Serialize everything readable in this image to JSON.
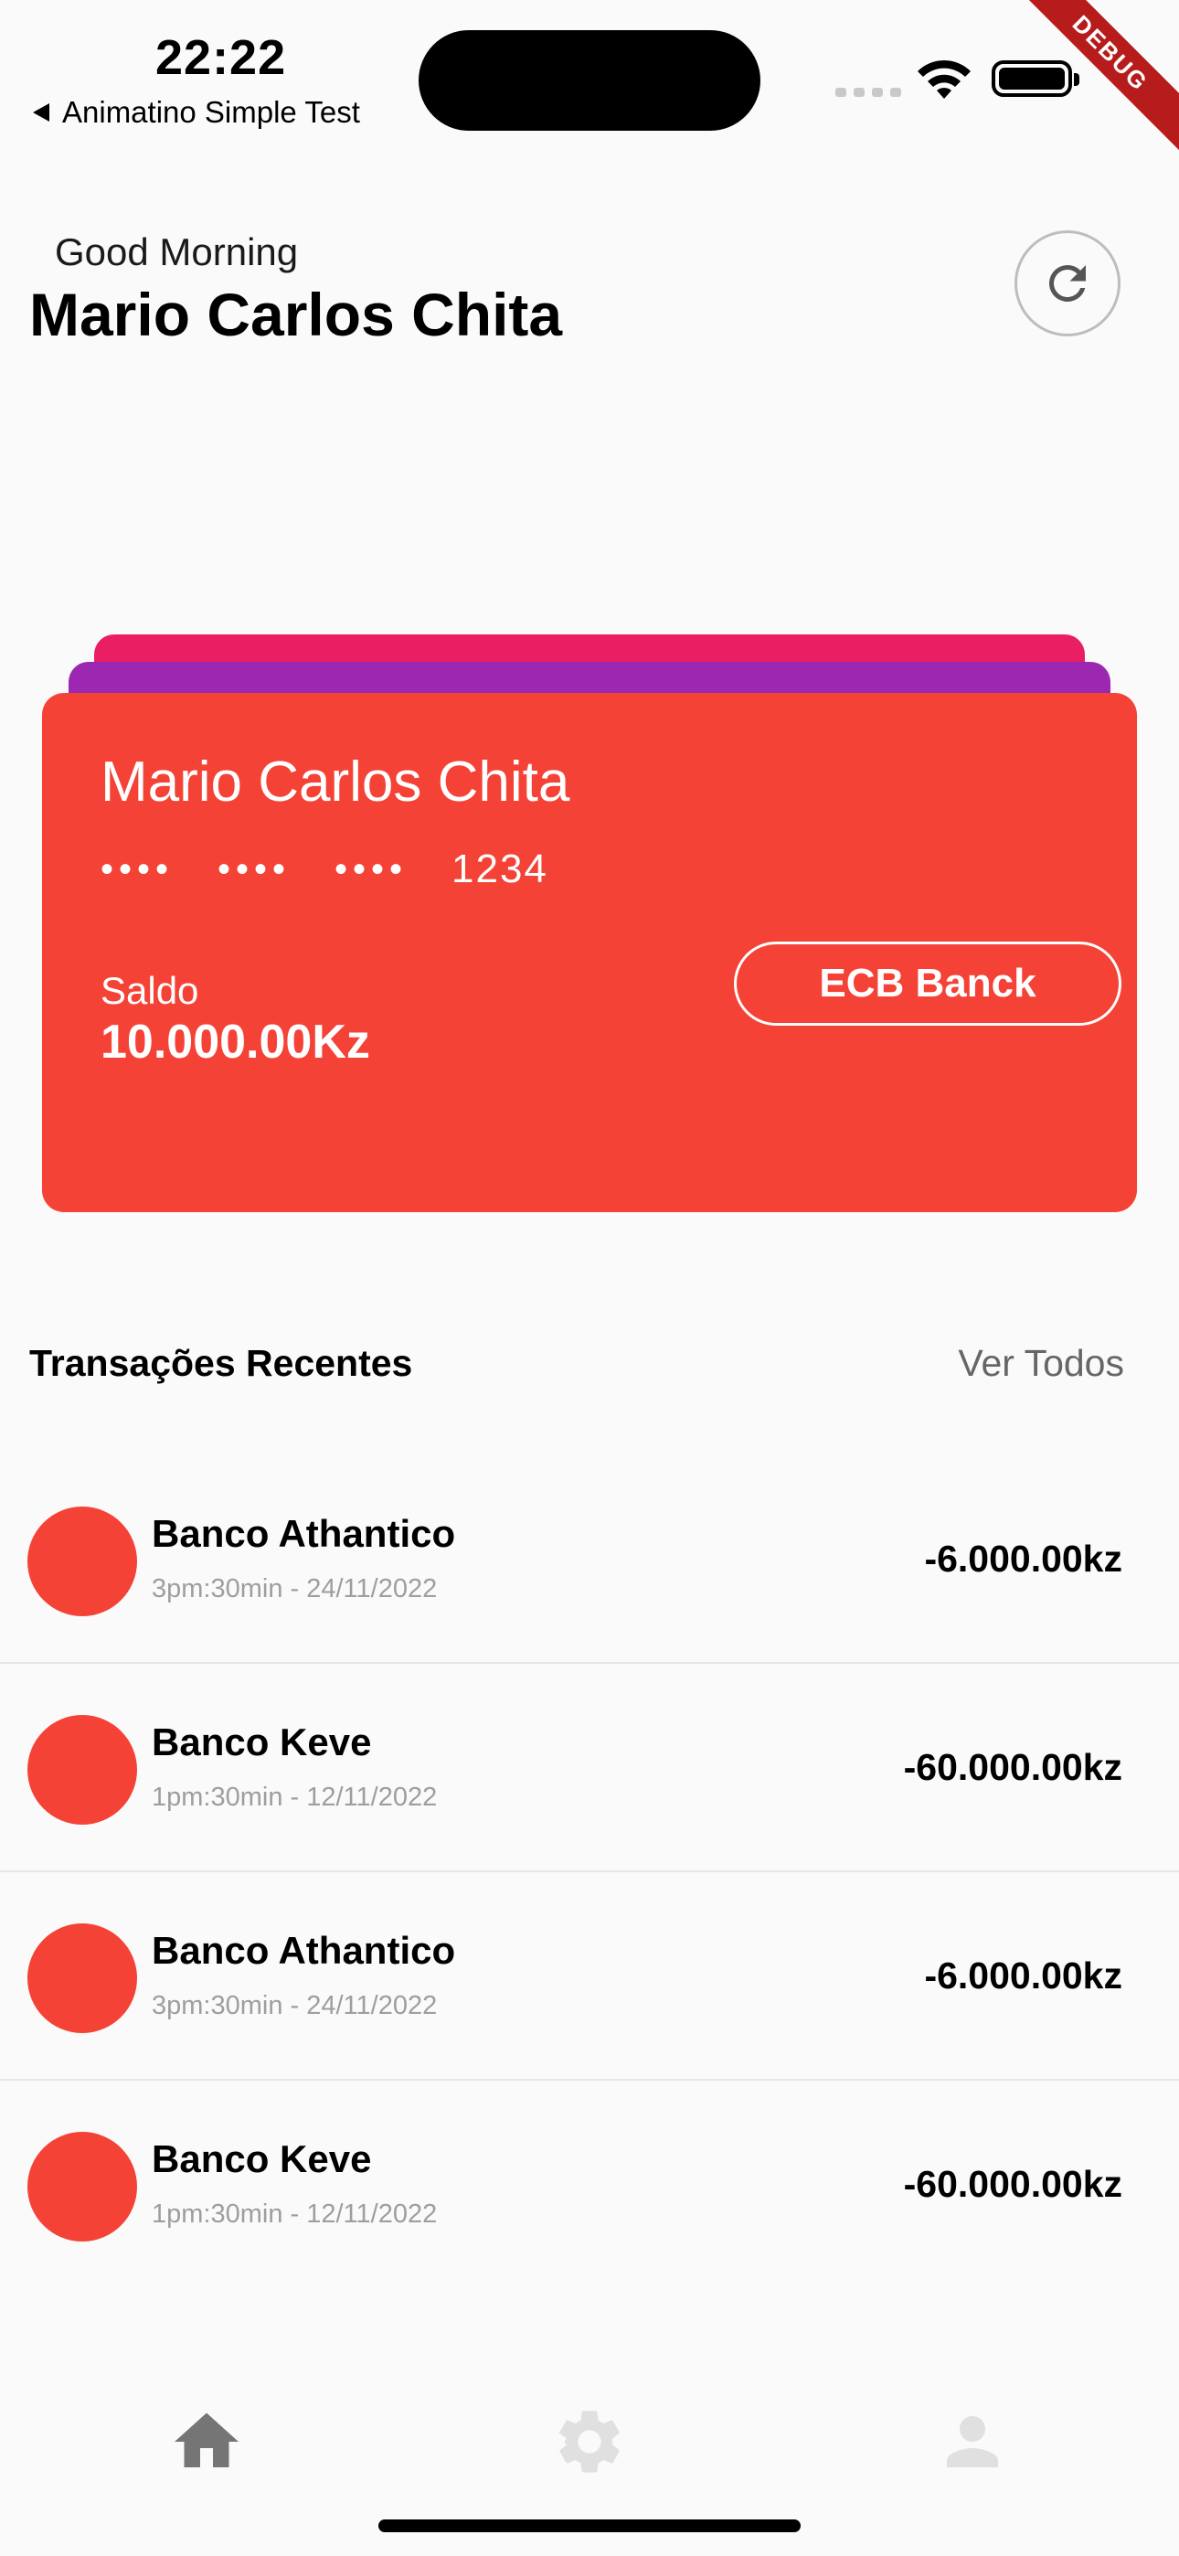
{
  "status_bar": {
    "time": "22:22",
    "back_app": "Animatino Simple Test",
    "debug_label": "DEBUG"
  },
  "header": {
    "greeting": "Good Morning",
    "username": "Mario Carlos Chita",
    "refresh_icon": "refresh-icon"
  },
  "card": {
    "holder": "Mario Carlos Chita",
    "masked_groups": [
      "••••",
      "••••",
      "••••"
    ],
    "last_digits": "1234",
    "balance_label": "Saldo",
    "balance_value": "10.000.00Kz",
    "bank_button": "ECB Banck",
    "colors": {
      "main": "#f44336",
      "back1": "#e91e63",
      "back2": "#9c27b0"
    }
  },
  "recent": {
    "title": "Transações Recentes",
    "see_all": "Ver Todos",
    "items": [
      {
        "name": "Banco Athantico",
        "time": "3pm:30min - 24/11/2022",
        "amount": "-6.000.00kz"
      },
      {
        "name": "Banco Keve",
        "time": "1pm:30min - 12/11/2022",
        "amount": "-60.000.00kz"
      },
      {
        "name": "Banco Athantico",
        "time": "3pm:30min - 24/11/2022",
        "amount": "-6.000.00kz"
      },
      {
        "name": "Banco Keve",
        "time": "1pm:30min - 12/11/2022",
        "amount": "-60.000.00kz"
      }
    ]
  },
  "bottom_nav": {
    "items": [
      {
        "icon": "home-icon",
        "active": true
      },
      {
        "icon": "settings-icon",
        "active": false
      },
      {
        "icon": "person-icon",
        "active": false
      }
    ],
    "active_color": "#757575",
    "inactive_color": "#e0e0e0"
  }
}
